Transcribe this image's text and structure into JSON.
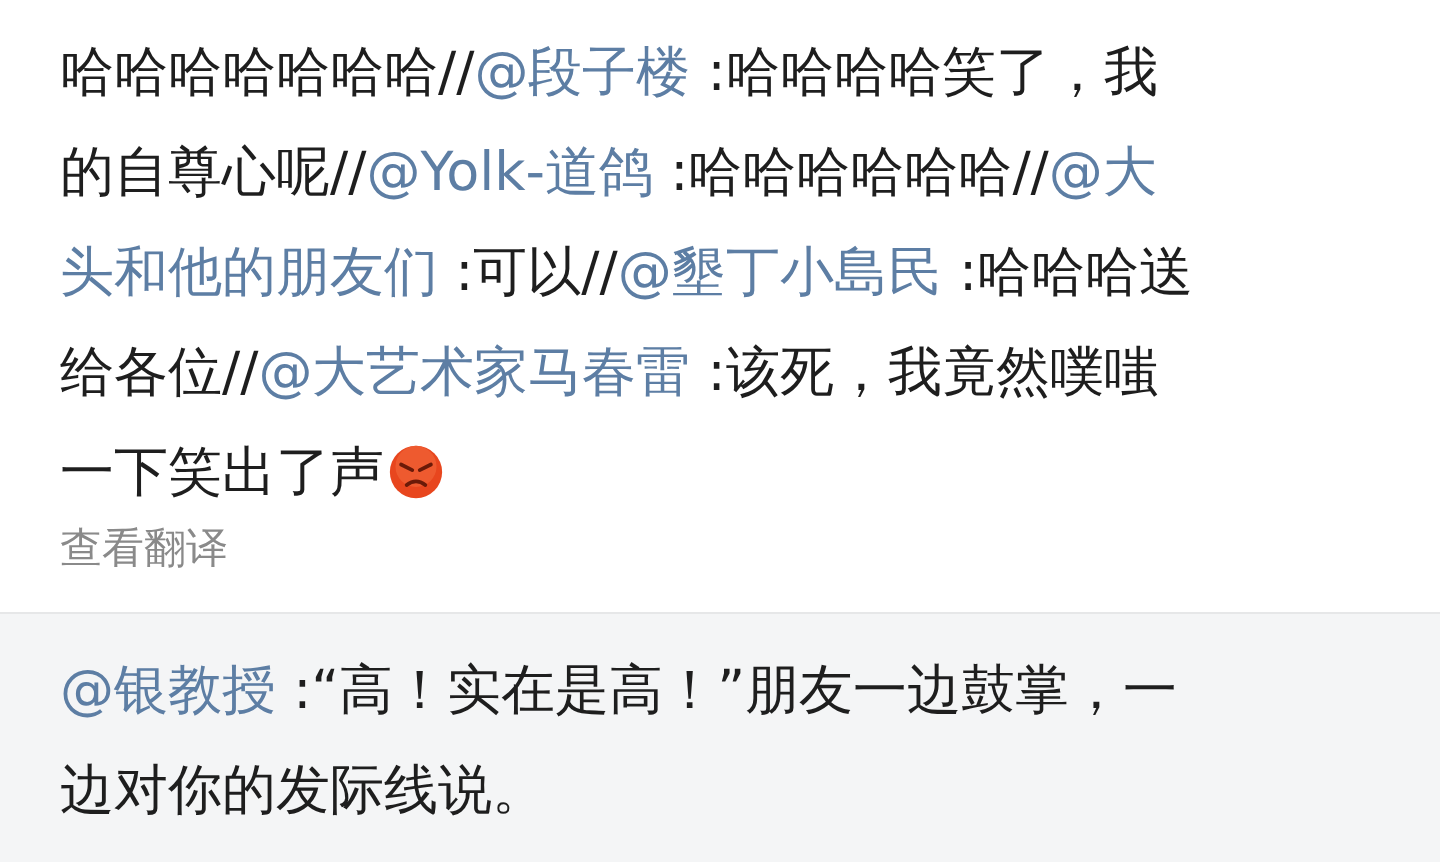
{
  "comment": {
    "lines": [
      [
        {
          "kind": "text",
          "text": "哈哈哈哈哈哈哈//"
        },
        {
          "kind": "mention",
          "text": "@段子楼"
        },
        {
          "kind": "text",
          "text": " :哈哈哈哈笑了，我"
        }
      ],
      [
        {
          "kind": "text",
          "text": "的自尊心呢//"
        },
        {
          "kind": "mention",
          "text": "@Yolk-道鸽"
        },
        {
          "kind": "text",
          "text": " :哈哈哈哈哈哈//"
        },
        {
          "kind": "mention",
          "text": "@大"
        }
      ],
      [
        {
          "kind": "mention",
          "text": "头和他的朋友们"
        },
        {
          "kind": "text",
          "text": " :可以//"
        },
        {
          "kind": "mention",
          "text": "@墾丁小島民"
        },
        {
          "kind": "text",
          "text": " :哈哈哈送"
        }
      ],
      [
        {
          "kind": "text",
          "text": "给各位//"
        },
        {
          "kind": "mention",
          "text": "@大艺术家马春雷"
        },
        {
          "kind": "text",
          "text": " :该死，我竟然噗嗤"
        }
      ],
      [
        {
          "kind": "text",
          "text": "一下笑出了声"
        },
        {
          "kind": "emoji"
        }
      ]
    ],
    "translate_link": "查看翻译"
  },
  "reply": {
    "lines": [
      [
        {
          "kind": "mention",
          "text": "@银教授"
        },
        {
          "kind": "text",
          "text": " :“高！实在是高！”朋友一边鼓掌，一"
        }
      ],
      [
        {
          "kind": "text",
          "text": "边对你的发际线说。"
        }
      ]
    ]
  }
}
